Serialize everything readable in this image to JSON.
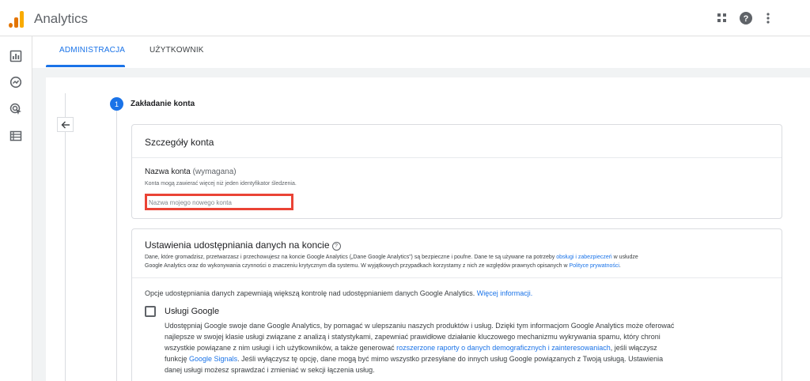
{
  "app": {
    "title": "Analytics",
    "accent": "#1a73e8",
    "logo_colors": [
      "#e37400",
      "#f9ab00"
    ]
  },
  "topbar": {
    "icons": [
      "apps-grid-icon",
      "help-icon",
      "more-vert-icon"
    ]
  },
  "leftnav": {
    "icons": [
      "reports-icon",
      "explore-icon",
      "advertising-icon",
      "configure-icon"
    ]
  },
  "tabs": [
    {
      "label": "ADMINISTRACJA",
      "active": true
    },
    {
      "label": "UŻYTKOWNIK",
      "active": false
    }
  ],
  "step": {
    "number": "1",
    "title": "Zakładanie konta"
  },
  "account_details": {
    "title": "Szczegóły konta",
    "name_label": "Nazwa konta",
    "name_required": "(wymagana)",
    "hint": "Konta mogą zawierać więcej niż jeden identyfikator śledzenia.",
    "input_value": "",
    "input_placeholder": "Nazwa mojego nowego konta"
  },
  "sharing": {
    "title": "Ustawienia udostępniania danych na koncie",
    "desc_part1": "Dane, które gromadzisz, przetwarzasz i przechowujesz na koncie Google Analytics („Dane Google Analytics”) są bezpieczne i poufne. Dane te są używane na potrzeby ",
    "desc_link1": "obsługi i zabezpieczeń",
    "desc_part2": " w usłudze",
    "desc_part3": "Google Analytics oraz do wykonywania czynności o znaczeniu krytycznym dla systemu. W wyjątkowych przypadkach korzystamy z nich ze względów prawnych opisanych w ",
    "desc_link2": "Polityce prywatności",
    "desc_part4": ".",
    "intro": "Opcje udostępniania danych zapewniają większą kontrolę nad udostępnianiem danych Google Analytics. ",
    "intro_link": "Więcej informacji.",
    "option": {
      "label": "Usługi Google",
      "checked": false,
      "line1": "Udostępniaj Google swoje dane Google Analytics, by pomagać w ulepszaniu naszych produktów i usług. Dzięki tym informacjom Google Analytics może oferować",
      "line2": "najlepsze w swojej klasie usługi związane z analizą i statystykami, zapewniać prawidłowe działanie kluczowego mechanizmu wykrywania spamu, który chroni",
      "line3a": "wszystkie powiązane z nim usługi i ich użytkowników, a także generować ",
      "line3_link": "rozszerzone raporty o danych demograficznych i zainteresowaniach",
      "line3b": ", jeśli włączysz",
      "line4a": "funkcję ",
      "line4_link": "Google Signals",
      "line4b": ". Jeśli wyłączysz tę opcję, dane mogą być mimo wszystko przesyłane do innych usług Google powiązanych z Twoją usługą. Ustawienia",
      "line5": "danej usługi możesz sprawdzać i zmieniać w sekcji łączenia usług."
    }
  }
}
